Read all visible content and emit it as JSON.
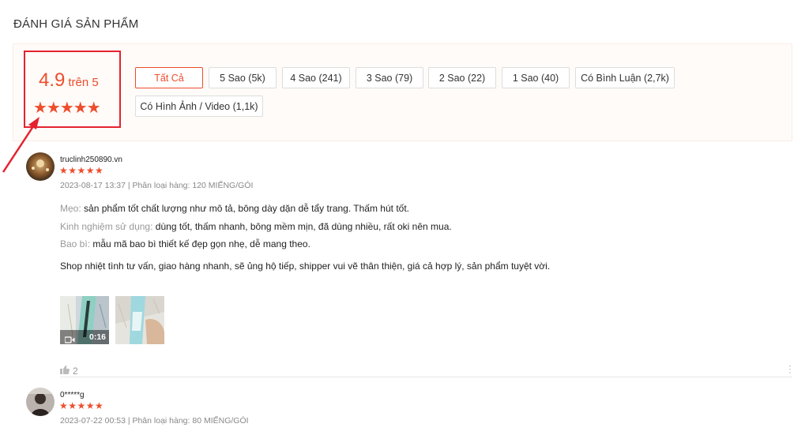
{
  "section_title": "ĐÁNH GIÁ SẢN PHẨM",
  "overview": {
    "score": "4.9",
    "out_of": "trên 5",
    "stars": "★★★★★",
    "rating_value": 4.9
  },
  "filters": [
    {
      "label": "Tất Cả",
      "active": true
    },
    {
      "label": "5 Sao (5k)"
    },
    {
      "label": "4 Sao (241)"
    },
    {
      "label": "3 Sao (79)"
    },
    {
      "label": "2 Sao (22)"
    },
    {
      "label": "1 Sao (40)"
    },
    {
      "label": "Có Bình Luận (2,7k)"
    },
    {
      "label": "Có Hình Ảnh / Video (1,1k)"
    }
  ],
  "reviews": [
    {
      "username": "truclinh250890.vn",
      "stars": "★★★★★",
      "meta": "2023-08-17 13:37 | Phân loại hàng: 120 MIẾNG/GÓI",
      "tip_label": "Mẹo:",
      "tip": "sản phẩm tốt chất lượng như mô tả, bông dày dặn dễ tẩy trang. Thấm hút tốt.",
      "experience_label": "Kinh nghiệm sử dụng:",
      "experience": "dùng tốt, thấm nhanh, bông mềm mịn, đã dùng nhiều, rất oki nên mua.",
      "packaging_label": "Bao bì:",
      "packaging": "mẫu mã bao bì thiết kế đẹp gọn nhẹ, dễ mang theo.",
      "comment": "Shop nhiệt tình tư vấn, giao hàng nhanh, sẽ ủng hộ tiếp, shipper vui vẽ thân thiện, giá cả hợp lý, sản phẩm tuyệt vời.",
      "video_duration": "0:16",
      "likes": "2"
    },
    {
      "username": "0*****g",
      "stars": "★★★★★",
      "meta": "2023-07-22 00:53 | Phân loại hàng: 80 MIẾNG/GÓI"
    }
  ],
  "colors": {
    "accent": "#ee4d2d",
    "highlight_box": "#e5222f"
  }
}
